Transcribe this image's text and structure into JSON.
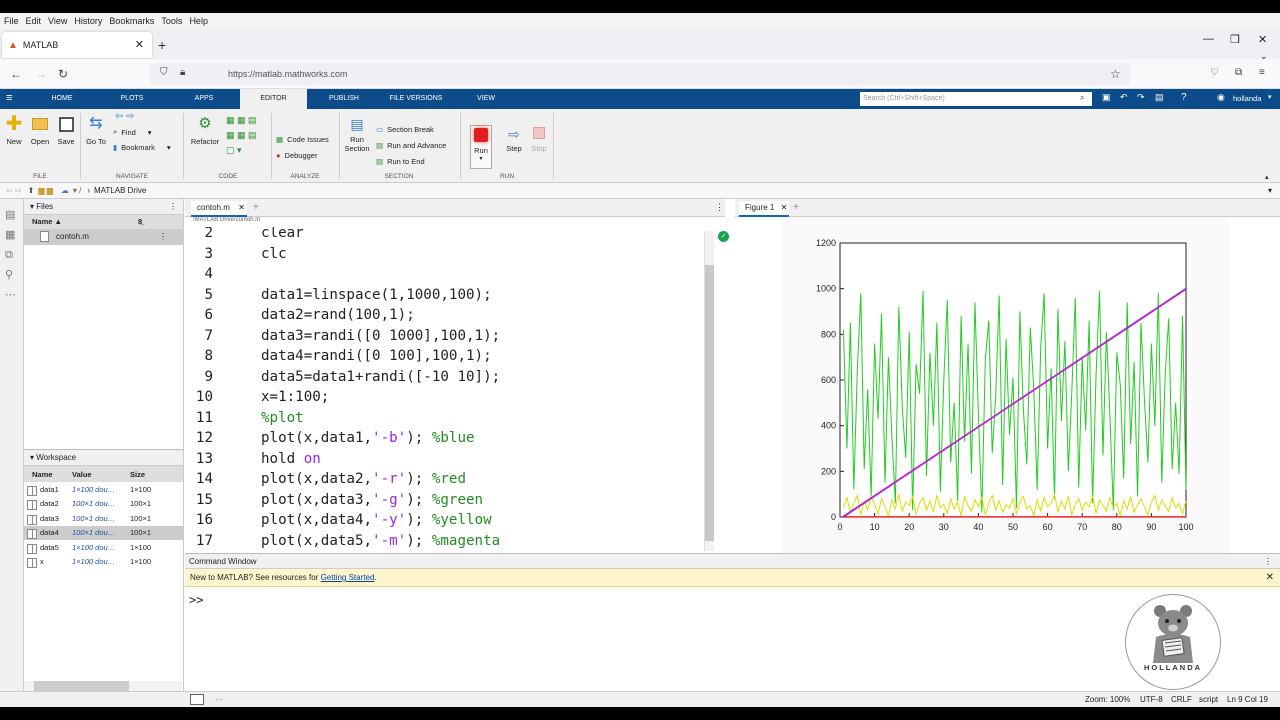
{
  "os_menu": [
    "File",
    "Edit",
    "View",
    "History",
    "Bookmarks",
    "Tools",
    "Help"
  ],
  "browser": {
    "tab_title": "MATLAB",
    "url": "https://matlab.mathworks.com"
  },
  "ml_tabs": [
    "HOME",
    "PLOTS",
    "APPS",
    "EDITOR",
    "PUBLISH",
    "FILE VERSIONS",
    "VIEW"
  ],
  "search_placeholder": "Search (Ctrl+Shift+Space)",
  "user": "hollanda",
  "toolstrip": {
    "new": "New",
    "open": "Open",
    "save": "Save",
    "file_group": "FILE",
    "goto": "Go To",
    "find": "Find",
    "bookmark": "Bookmark",
    "navigate_group": "NAVIGATE",
    "refactor": "Refactor",
    "code_group": "CODE",
    "code_issues": "Code Issues",
    "debugger": "Debugger",
    "analyze_group": "ANALYZE",
    "run_section_1": "Run",
    "run_section_2": "Section",
    "section_break": "Section Break",
    "run_advance": "Run and Advance",
    "run_end": "Run to End",
    "section_group": "SECTION",
    "run": "Run",
    "step": "Step",
    "stop": "Stop",
    "run_group": "RUN"
  },
  "path": "MATLAB Drive",
  "files": {
    "title": "Files",
    "col_name": "Name ▲",
    "items": [
      "contoh.m"
    ]
  },
  "workspace": {
    "title": "Workspace",
    "cols": [
      "Name",
      "Value",
      "Size"
    ],
    "rows": [
      {
        "name": "data1",
        "value": "1×100 dou…",
        "size": "1×100"
      },
      {
        "name": "data2",
        "value": "100×1 dou…",
        "size": "100×1"
      },
      {
        "name": "data3",
        "value": "100×1 dou…",
        "size": "100×1"
      },
      {
        "name": "data4",
        "value": "100×1 dou…",
        "size": "100×1"
      },
      {
        "name": "data5",
        "value": "1×100 dou…",
        "size": "1×100"
      },
      {
        "name": "x",
        "value": "1×100 dou…",
        "size": "1×100"
      }
    ]
  },
  "editor": {
    "tab": "contoh.m",
    "path": "/MATLAB Drive/contoh.m"
  },
  "figure": {
    "tab": "Figure 1"
  },
  "chart_data": {
    "type": "line",
    "xlim": [
      0,
      100
    ],
    "ylim": [
      0,
      1200
    ],
    "xticks": [
      "0",
      "10",
      "20",
      "30",
      "40",
      "50",
      "60",
      "70",
      "80",
      "90",
      "100"
    ],
    "yticks": [
      "0",
      "200",
      "400",
      "600",
      "800",
      "1000",
      "1200"
    ],
    "series": [
      {
        "color": "#22cc22",
        "x": [
          1,
          2,
          3,
          4,
          5,
          6,
          7,
          8,
          9,
          10,
          11,
          12,
          13,
          14,
          15,
          16,
          17,
          18,
          19,
          20,
          21,
          22,
          23,
          24,
          25,
          26,
          27,
          28,
          29,
          30,
          31,
          32,
          33,
          34,
          35,
          36,
          37,
          38,
          39,
          40,
          41,
          42,
          43,
          44,
          45,
          46,
          47,
          48,
          49,
          50,
          51,
          52,
          53,
          54,
          55,
          56,
          57,
          58,
          59,
          60,
          61,
          62,
          63,
          64,
          65,
          66,
          67,
          68,
          69,
          70,
          71,
          72,
          73,
          74,
          75,
          76,
          77,
          78,
          79,
          80,
          81,
          82,
          83,
          84,
          85,
          86,
          87,
          88,
          89,
          90,
          91,
          92,
          93,
          94,
          95,
          96,
          97,
          98,
          99,
          100
        ],
        "values": [
          820,
          300,
          850,
          120,
          640,
          980,
          210,
          560,
          90,
          760,
          430,
          890,
          150,
          700,
          350,
          60,
          920,
          480,
          260,
          810,
          30,
          670,
          540,
          990,
          180,
          720,
          400,
          850,
          110,
          600,
          950,
          240,
          500,
          70,
          880,
          330,
          760,
          190,
          940,
          450,
          20,
          690,
          860,
          280,
          530,
          970,
          140,
          780,
          360,
          610,
          40,
          900,
          470,
          230,
          830,
          560,
          120,
          740,
          980,
          300,
          650,
          80,
          910,
          420,
          770,
          200,
          550,
          960,
          130,
          700,
          380,
          860,
          60,
          620,
          990,
          270,
          810,
          450,
          30,
          720,
          580,
          170,
          940,
          320,
          680,
          90,
          850,
          510,
          240,
          760,
          400,
          980,
          150,
          630,
          870,
          210,
          500,
          190,
          880,
          120
        ]
      },
      {
        "color": "#dddd00",
        "x": [
          1,
          2,
          3,
          4,
          5,
          6,
          7,
          8,
          9,
          10,
          11,
          12,
          13,
          14,
          15,
          16,
          17,
          18,
          19,
          20,
          21,
          22,
          23,
          24,
          25,
          26,
          27,
          28,
          29,
          30,
          31,
          32,
          33,
          34,
          35,
          36,
          37,
          38,
          39,
          40,
          41,
          42,
          43,
          44,
          45,
          46,
          47,
          48,
          49,
          50,
          51,
          52,
          53,
          54,
          55,
          56,
          57,
          58,
          59,
          60,
          61,
          62,
          63,
          64,
          65,
          66,
          67,
          68,
          69,
          70,
          71,
          72,
          73,
          74,
          75,
          76,
          77,
          78,
          79,
          80,
          81,
          82,
          83,
          84,
          85,
          86,
          87,
          88,
          89,
          90,
          91,
          92,
          93,
          94,
          95,
          96,
          97,
          98,
          99,
          100
        ],
        "values": [
          40,
          85,
          20,
          60,
          95,
          10,
          70,
          30,
          90,
          55,
          15,
          80,
          45,
          5,
          75,
          35,
          100,
          25,
          65,
          50,
          90,
          10,
          60,
          85,
          30,
          70,
          20,
          95,
          40,
          55,
          15,
          80,
          35,
          65,
          5,
          90,
          50,
          25,
          75,
          45,
          85,
          10,
          60,
          95,
          30,
          70,
          20,
          55,
          40,
          80,
          15,
          65,
          90,
          35,
          50,
          5,
          75,
          25,
          85,
          45,
          60,
          100,
          20,
          70,
          35,
          90,
          10,
          55,
          80,
          30,
          65,
          45,
          95,
          15,
          75,
          50,
          25,
          85,
          40,
          60,
          5,
          70,
          35,
          90,
          20,
          55,
          80,
          45,
          10,
          65,
          95,
          30,
          75,
          50,
          25,
          85,
          40,
          60,
          15,
          70
        ]
      },
      {
        "color": "#ee2222",
        "x": [
          1,
          100
        ],
        "values": [
          0.5,
          0.5
        ]
      },
      {
        "color": "#2222ee",
        "x": [
          1,
          100
        ],
        "values": [
          1,
          1000
        ]
      },
      {
        "color": "#cc22cc",
        "x": [
          1,
          100
        ],
        "values": [
          3,
          998
        ]
      }
    ]
  },
  "command_window": {
    "title": "Command Window",
    "banner": "New to MATLAB? See resources for ",
    "banner_link": "Getting Started",
    "banner_end": ".",
    "prompt": ">>"
  },
  "status": {
    "zoom": "Zoom: 100%",
    "encoding": "UTF-8",
    "eol": "CRLF",
    "type": "script",
    "pos": "Ln 9 Col 19"
  },
  "logo_text": "HOLLANDA"
}
